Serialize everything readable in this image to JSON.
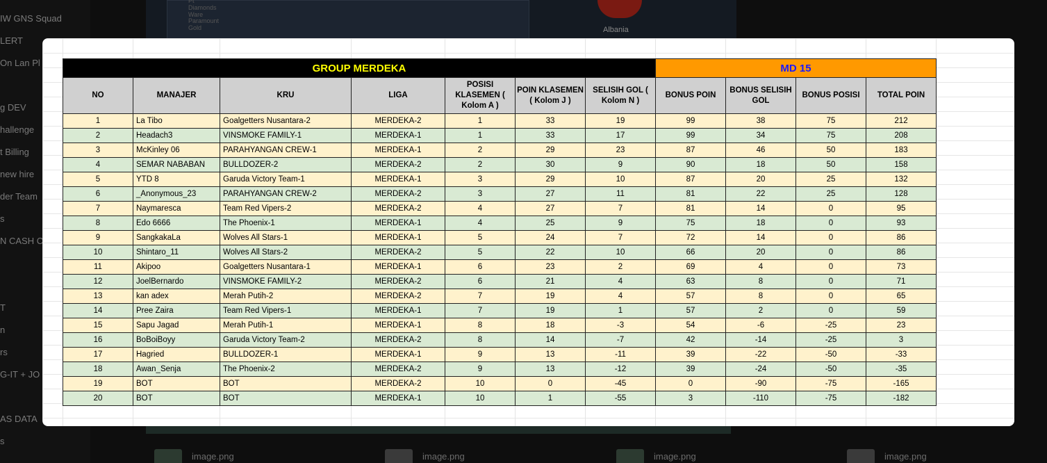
{
  "background": {
    "sidebar_items": [
      "IW GNS Squad",
      "LERT",
      "On Lan Pl",
      "g DEV",
      "hallenge",
      "t Billing",
      "new hire",
      "der Team",
      "s",
      "N CASH C",
      "T",
      "n",
      "rs",
      "G-IT + JO",
      "AS DATA",
      "s"
    ],
    "country_label": "Albania",
    "team_row_1": "Pt Diamonds Ware",
    "team_row_2": "Paramount Gold",
    "files": [
      "image.png",
      "image.png",
      "image.png",
      "image.png"
    ]
  },
  "sheet": {
    "group_title": "GROUP MERDEKA",
    "matchday": "MD 15",
    "headers": [
      {
        "key": "no",
        "label": "NO"
      },
      {
        "key": "manajer",
        "label": "MANAJER"
      },
      {
        "key": "kru",
        "label": "KRU"
      },
      {
        "key": "liga",
        "label": "LIGA"
      },
      {
        "key": "posisi",
        "label": "POSISI KLASEMEN ( Kolom A )"
      },
      {
        "key": "poin",
        "label": "POIN KLASEMEN ( Kolom J )"
      },
      {
        "key": "selisih",
        "label": "SELISIH GOL ( Kolom N )"
      },
      {
        "key": "bonus_poin",
        "label": "BONUS POIN"
      },
      {
        "key": "bonus_selisih",
        "label": "BONUS SELISIH GOL"
      },
      {
        "key": "bonus_posisi",
        "label": "BONUS POSISI"
      },
      {
        "key": "total",
        "label": "TOTAL POIN"
      }
    ],
    "rows": [
      [
        "1",
        "La Tibo",
        "Goalgetters Nusantara-2",
        "MERDEKA-2",
        "1",
        "33",
        "19",
        "99",
        "38",
        "75",
        "212"
      ],
      [
        "2",
        "Headach3",
        "VINSMOKE FAMILY-1",
        "MERDEKA-1",
        "1",
        "33",
        "17",
        "99",
        "34",
        "75",
        "208"
      ],
      [
        "3",
        "McKinley 06",
        "PARAHYANGAN CREW-1",
        "MERDEKA-1",
        "2",
        "29",
        "23",
        "87",
        "46",
        "50",
        "183"
      ],
      [
        "4",
        "SEMAR NABABAN",
        "BULLDOZER-2",
        "MERDEKA-2",
        "2",
        "30",
        "9",
        "90",
        "18",
        "50",
        "158"
      ],
      [
        "5",
        "YTD 8",
        "Garuda Victory Team-1",
        "MERDEKA-1",
        "3",
        "29",
        "10",
        "87",
        "20",
        "25",
        "132"
      ],
      [
        "6",
        "_Anonymous_23",
        "PARAHYANGAN CREW-2",
        "MERDEKA-2",
        "3",
        "27",
        "11",
        "81",
        "22",
        "25",
        "128"
      ],
      [
        "7",
        "Naymaresca",
        "Team Red Vipers-2",
        "MERDEKA-2",
        "4",
        "27",
        "7",
        "81",
        "14",
        "0",
        "95"
      ],
      [
        "8",
        "Edo 6666",
        "The Phoenix-1",
        "MERDEKA-1",
        "4",
        "25",
        "9",
        "75",
        "18",
        "0",
        "93"
      ],
      [
        "9",
        "SangkakaLa",
        "Wolves All Stars-1",
        "MERDEKA-1",
        "5",
        "24",
        "7",
        "72",
        "14",
        "0",
        "86"
      ],
      [
        "10",
        "Shintaro_11",
        "Wolves All Stars-2",
        "MERDEKA-2",
        "5",
        "22",
        "10",
        "66",
        "20",
        "0",
        "86"
      ],
      [
        "11",
        "Akipoo",
        "Goalgetters Nusantara-1",
        "MERDEKA-1",
        "6",
        "23",
        "2",
        "69",
        "4",
        "0",
        "73"
      ],
      [
        "12",
        "JoelBernardo",
        "VINSMOKE FAMILY-2",
        "MERDEKA-2",
        "6",
        "21",
        "4",
        "63",
        "8",
        "0",
        "71"
      ],
      [
        "13",
        "kan adex",
        "Merah Putih-2",
        "MERDEKA-2",
        "7",
        "19",
        "4",
        "57",
        "8",
        "0",
        "65"
      ],
      [
        "14",
        "Pree Zaira",
        "Team Red Vipers-1",
        "MERDEKA-1",
        "7",
        "19",
        "1",
        "57",
        "2",
        "0",
        "59"
      ],
      [
        "15",
        "Sapu Jagad",
        "Merah Putih-1",
        "MERDEKA-1",
        "8",
        "18",
        "-3",
        "54",
        "-6",
        "-25",
        "23"
      ],
      [
        "16",
        "BoBoiBoyy",
        "Garuda Victory Team-2",
        "MERDEKA-2",
        "8",
        "14",
        "-7",
        "42",
        "-14",
        "-25",
        "3"
      ],
      [
        "17",
        "Hagried",
        "BULLDOZER-1",
        "MERDEKA-1",
        "9",
        "13",
        "-11",
        "39",
        "-22",
        "-50",
        "-33"
      ],
      [
        "18",
        "Awan_Senja",
        "The Phoenix-2",
        "MERDEKA-2",
        "9",
        "13",
        "-12",
        "39",
        "-24",
        "-50",
        "-35"
      ],
      [
        "19",
        "BOT",
        "BOT",
        "MERDEKA-2",
        "10",
        "0",
        "-45",
        "0",
        "-90",
        "-75",
        "-165"
      ],
      [
        "20",
        "BOT",
        "BOT",
        "MERDEKA-1",
        "10",
        "1",
        "-55",
        "3",
        "-110",
        "-75",
        "-182"
      ]
    ]
  },
  "colors": {
    "title_bg": "#000000",
    "title_text": "#ffff00",
    "md_bg": "#ff9900",
    "md_text": "#1a1aff",
    "header_bg": "#d0d0d0",
    "row_odd": "#fff2cc",
    "row_even": "#d9ead3"
  }
}
